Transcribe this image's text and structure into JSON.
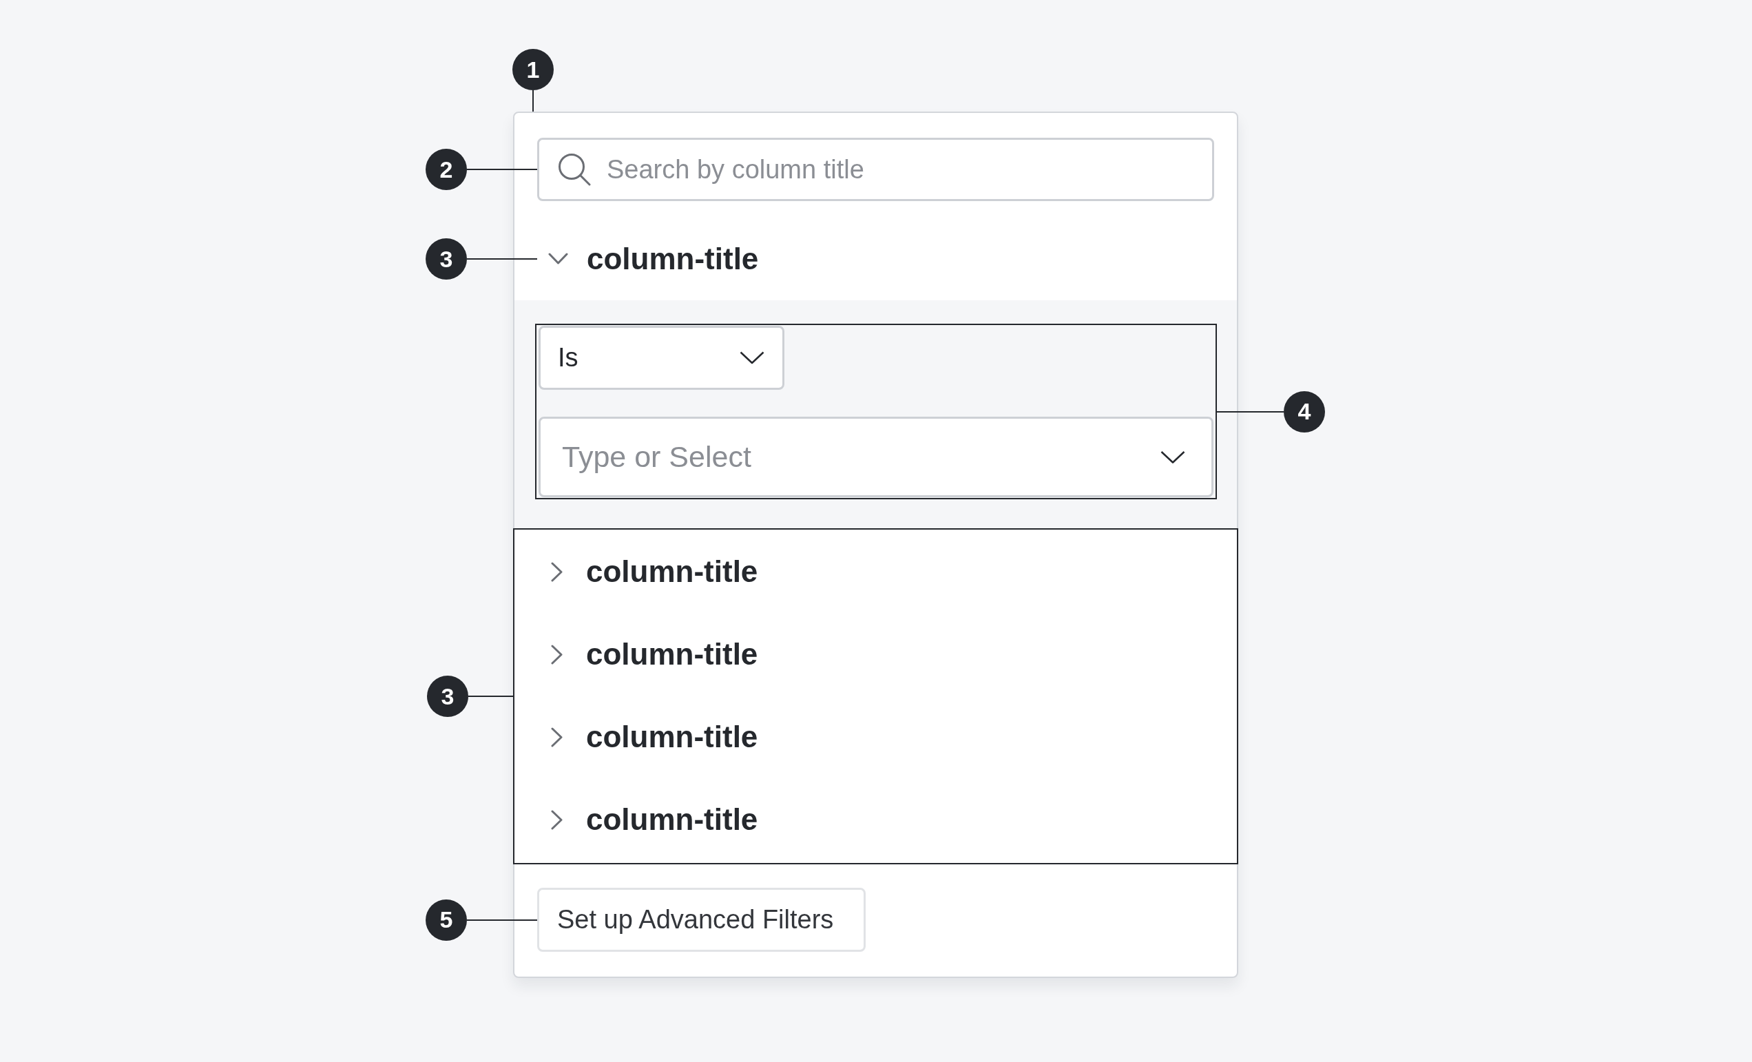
{
  "filter_panel": {
    "callout": "1",
    "search": {
      "placeholder": "Search by column title",
      "callout": "2"
    },
    "columns": [
      {
        "title": "column-title",
        "expanded": true,
        "callout": "3",
        "filter": {
          "callout": "4",
          "operator": "Is",
          "value_placeholder": "Type or Select"
        }
      },
      {
        "title": "column-title",
        "expanded": false
      },
      {
        "title": "column-title",
        "expanded": false
      },
      {
        "title": "column-title",
        "expanded": false
      },
      {
        "title": "column-title",
        "expanded": false
      }
    ],
    "collapsed_columns_callout": "3",
    "advanced_filters_button": {
      "label": "Set up Advanced Filters",
      "callout": "5"
    }
  }
}
